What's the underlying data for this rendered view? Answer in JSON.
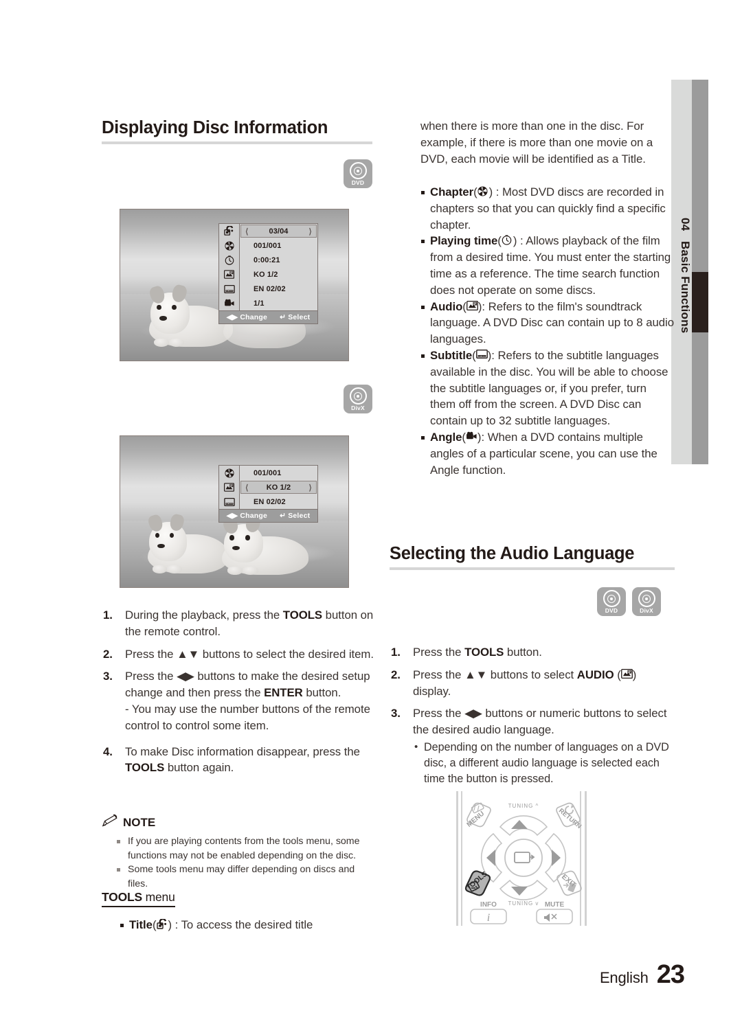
{
  "sidebar": {
    "number": "04",
    "label": "Basic Functions"
  },
  "footer": {
    "language": "English",
    "page": "23"
  },
  "left_column": {
    "heading": "Displaying Disc Information",
    "badge_top": {
      "icon": "dvd-disc-icon",
      "label": "DVD"
    },
    "badge_mid": {
      "icon": "divx-disc-icon",
      "label": "DivX"
    },
    "screenshot_1": {
      "caption": "puppy-osd-full",
      "osd": {
        "rows": [
          {
            "icon": "title-icon",
            "value": "03/04",
            "selected": true
          },
          {
            "icon": "chapter-icon",
            "value": "001/001",
            "selected": false
          },
          {
            "icon": "playing-time-icon",
            "value": "0:00:21",
            "selected": false
          },
          {
            "icon": "audio-icon",
            "value": "KO 1/2",
            "selected": false
          },
          {
            "icon": "subtitle-icon",
            "value": "EN 02/02",
            "selected": false
          },
          {
            "icon": "angle-icon",
            "value": "1/1",
            "selected": false
          }
        ],
        "footer_change": "Change",
        "footer_select": "Select"
      }
    },
    "screenshot_2": {
      "caption": "two-puppies-osd-divx",
      "osd": {
        "rows": [
          {
            "icon": "chapter-icon",
            "value": "001/001",
            "selected": false
          },
          {
            "icon": "audio-icon",
            "value": "KO 1/2",
            "selected": true
          },
          {
            "icon": "subtitle-icon",
            "value": "EN 02/02",
            "selected": false
          }
        ],
        "footer_change": "Change",
        "footer_select": "Select"
      }
    },
    "steps": [
      {
        "num": "1.",
        "parts": [
          {
            "t": "During the playback, press the "
          },
          {
            "t": "TOOLS",
            "b": true
          },
          {
            "t": " button on the remote control."
          }
        ]
      },
      {
        "num": "2.",
        "parts": [
          {
            "t": "Press the "
          },
          {
            "t": "▲▼",
            "b": false
          },
          {
            "t": " buttons to select the desired item."
          }
        ]
      },
      {
        "num": "3.",
        "parts": [
          {
            "t": "Press the "
          },
          {
            "t": "◀▶"
          },
          {
            "t": " buttons to make the desired setup change and then press the "
          },
          {
            "t": "ENTER",
            "b": true
          },
          {
            "t": " button."
          }
        ],
        "sub": "- You may use the number buttons of the remote control to control some item."
      },
      {
        "num": "4.",
        "parts": [
          {
            "t": "To make Disc information disappear, press the "
          },
          {
            "t": "TOOLS",
            "b": true
          },
          {
            "t": " button again."
          }
        ]
      }
    ],
    "note": {
      "title": "NOTE",
      "items": [
        "If you are playing contents from the tools menu, some functions may not be enabled depending on the disc.",
        "Some tools menu may differ depending on discs and files."
      ]
    },
    "tools_menu": {
      "head_bold": "TOOLS",
      "head_light": " menu",
      "item_label": "Title",
      "item_icon": "title-icon",
      "item_text": " : To access the desired title"
    }
  },
  "right_column": {
    "intro": "when there is more than one in the disc. For example, if there is more than one movie on a DVD, each movie will be identified as a Title.",
    "bullets": [
      {
        "label": "Chapter",
        "icon": "chapter-icon",
        "sep": " : ",
        "text": "Most DVD discs are recorded in chapters so that you can quickly find a specific chapter."
      },
      {
        "label": "Playing time",
        "icon": "playing-time-icon",
        "sep": " : ",
        "text": "Allows playback of the film from a desired time. You must enter the starting time as a reference. The time search function does not operate on some discs."
      },
      {
        "label": "Audio",
        "icon": "audio-icon",
        "sep": ": ",
        "text": "Refers to the film's soundtrack language. A DVD Disc can contain up to 8 audio languages."
      },
      {
        "label": "Subtitle",
        "icon": "subtitle-icon",
        "sep": ": ",
        "text": "Refers to the subtitle languages available in the disc. You will be able to choose the subtitle languages or, if you prefer, turn them off from the screen. A DVD Disc can contain up to 32 subtitle languages."
      },
      {
        "label": "Angle",
        "icon": "angle-icon",
        "sep": ": ",
        "text": "When a DVD contains multiple angles of a particular scene, you can use the Angle function."
      }
    ],
    "heading": "Selecting the Audio Language",
    "badges": [
      {
        "icon": "dvd-disc-icon",
        "label": "DVD"
      },
      {
        "icon": "divx-disc-icon",
        "label": "DivX"
      }
    ],
    "steps": [
      {
        "num": "1.",
        "parts": [
          {
            "t": "Press the "
          },
          {
            "t": "TOOLS",
            "b": true
          },
          {
            "t": " button."
          }
        ]
      },
      {
        "num": "2.",
        "parts": [
          {
            "t": "Press the "
          },
          {
            "t": "▲▼"
          },
          {
            "t": " buttons to select "
          },
          {
            "t": "AUDIO",
            "b": true
          },
          {
            "t": " (",
            "icon": "audio-icon"
          },
          {
            "t": ") display."
          }
        ]
      },
      {
        "num": "3.",
        "parts": [
          {
            "t": "Press the "
          },
          {
            "t": "◀▶"
          },
          {
            "t": " buttons or numeric buttons to select the desired audio language."
          }
        ],
        "dot": "Depending on the number of languages on a DVD disc, a different audio language is selected each time the button is pressed."
      }
    ],
    "remote": {
      "buttons": [
        {
          "name": "menu-button",
          "label": "MENU"
        },
        {
          "name": "return-button",
          "label": "RETURN"
        },
        {
          "name": "tuning-up-label",
          "label": "TUNING"
        },
        {
          "name": "tuning-down-label",
          "label": "TUNING"
        },
        {
          "name": "tools-button",
          "label": "TOOLS",
          "highlighted": true
        },
        {
          "name": "exit-button",
          "label": "EXIT"
        },
        {
          "name": "info-button",
          "label": "INFO"
        },
        {
          "name": "mute-button",
          "label": "MUTE"
        }
      ]
    }
  },
  "colors": {
    "text": "#231a17",
    "body_text": "#3a3330",
    "rule": "#d6d6d6",
    "badge_gray": "#a6a6a6",
    "tab_gray": "#9b9b9b",
    "tab_light": "#d9dad9",
    "tab_marker": "#2a201d"
  }
}
